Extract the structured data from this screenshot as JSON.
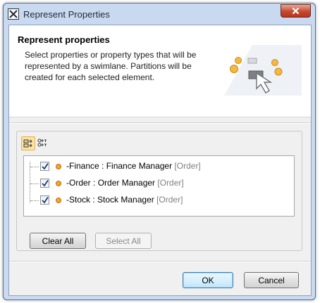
{
  "window": {
    "title": "Represent Properties"
  },
  "header": {
    "title": "Represent properties",
    "description": "Select properties or property types that will be represented by a swimlane. Partitions will be created for each selected element."
  },
  "toolbar": {
    "buttons": [
      {
        "icon": "represent-properties-icon",
        "active": true
      },
      {
        "icon": "represent-types-icon",
        "active": false
      }
    ]
  },
  "tree": {
    "items": [
      {
        "name": "-Finance",
        "sep": " : ",
        "type": "Finance Manager",
        "stereotype": " [Order]",
        "checked": true
      },
      {
        "name": "-Order",
        "sep": " : ",
        "type": "Order Manager",
        "stereotype": " [Order]",
        "checked": true
      },
      {
        "name": "-Stock",
        "sep": " : ",
        "type": "Stock Manager",
        "stereotype": " [Order]",
        "checked": true
      }
    ]
  },
  "buttons": {
    "clear_all": "Clear All",
    "select_all": "Select All",
    "ok": "OK",
    "cancel": "Cancel"
  },
  "colors": {
    "accent": "#3c7fb1",
    "property_icon": "#f6a623",
    "close_button": "#c6492f"
  }
}
